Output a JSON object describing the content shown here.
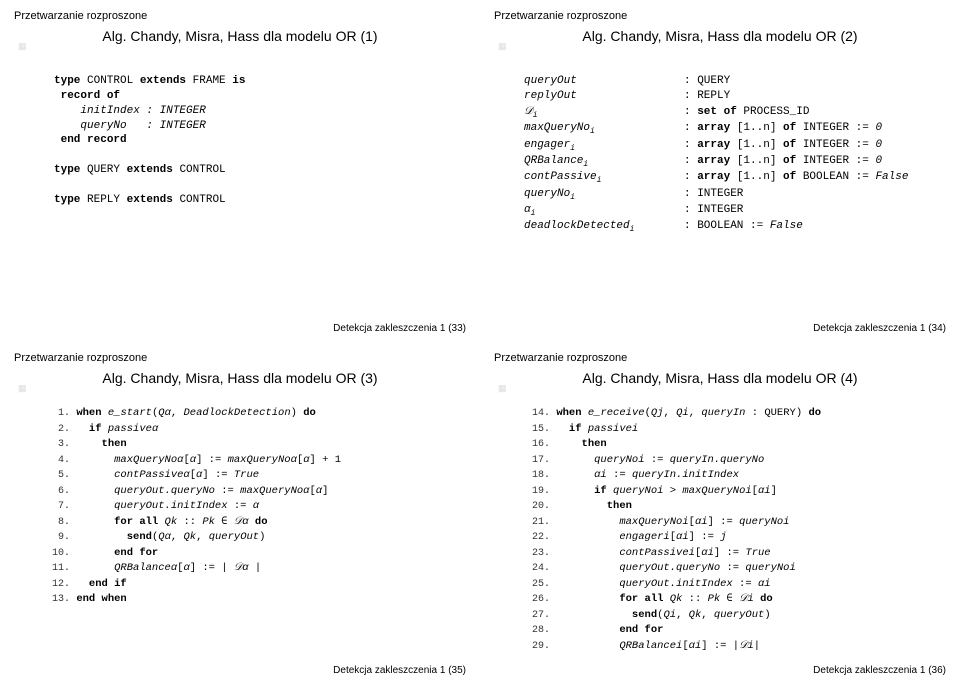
{
  "slides": {
    "s1": {
      "header": "Przetwarzanie rozproszone",
      "title": "Alg. Chandy, Misra, Hass dla modelu OR (1)",
      "footer": "Detekcja zakleszczenia 1 (33)",
      "code": {
        "l1a": "type",
        "l1b": " CONTROL ",
        "l1c": "extends",
        "l1d": " FRAME ",
        "l1e": "is",
        "l2a": "record of",
        "l3": "initIndex : INTEGER",
        "l4": "queryNo   : INTEGER",
        "l5a": "end record",
        "l6a": "type",
        "l6b": " QUERY ",
        "l6c": "extends",
        "l6d": " CONTROL",
        "l7a": "type",
        "l7b": " REPLY ",
        "l7c": "extends",
        "l7d": " CONTROL"
      }
    },
    "s2": {
      "header": "Przetwarzanie rozproszone",
      "title": "Alg. Chandy, Misra, Hass dla modelu OR (2)",
      "footer": "Detekcja zakleszczenia 1 (34)",
      "defs": [
        {
          "k": "queryOut",
          "v": ": QUERY"
        },
        {
          "k": "replyOut",
          "v": ": REPLY"
        },
        {
          "k": "𝒟",
          "sub": "i",
          "v": ": set of PROCESS_ID",
          "kw": "set of"
        },
        {
          "k": "maxQueryNo",
          "sub": "i",
          "v": ": array [1..n] of INTEGER := 0",
          "kw": "array",
          "kw2": "of"
        },
        {
          "k": "engager",
          "sub": "i",
          "v": ": array [1..n] of INTEGER := 0",
          "kw": "array",
          "kw2": "of"
        },
        {
          "k": "QRBalance",
          "sub": "i",
          "v": ": array [1..n] of INTEGER := 0",
          "kw": "array",
          "kw2": "of"
        },
        {
          "k": "contPassive",
          "sub": "i",
          "v": ": array [1..n] of BOOLEAN := False",
          "kw": "array",
          "kw2": "of"
        },
        {
          "k": "queryNo",
          "sub": "i",
          "v": ": INTEGER"
        },
        {
          "k": "α",
          "sub": "i",
          "v": ": INTEGER"
        },
        {
          "k": "deadlockDetected",
          "sub": "i",
          "v": ": BOOLEAN := False"
        }
      ]
    },
    "s3": {
      "header": "Przetwarzanie rozproszone",
      "title": "Alg. Chandy, Misra, Hass dla modelu OR (3)",
      "footer": "Detekcja zakleszczenia 1 (35)",
      "lines": [
        {
          "n": "1.",
          "t": "when e_start(Qα, DeadlockDetection) do",
          "kw": [
            "when",
            "do"
          ],
          "it": [
            "e_start",
            "Qα",
            "DeadlockDetection"
          ]
        },
        {
          "n": "2.",
          "t": "  if passiveα",
          "kw": [
            "if"
          ],
          "it": [
            "passiveα"
          ]
        },
        {
          "n": "3.",
          "t": "    then",
          "kw": [
            "then"
          ]
        },
        {
          "n": "4.",
          "t": "      maxQueryNoα[α] := maxQueryNoα[α] + 1",
          "it": [
            "maxQueryNoα",
            "α",
            "maxQueryNoα",
            "α"
          ]
        },
        {
          "n": "5.",
          "t": "      contPassiveα[α] := True",
          "it": [
            "contPassiveα",
            "α",
            "True"
          ]
        },
        {
          "n": "6.",
          "t": "      queryOut.queryNo := maxQueryNoα[α]",
          "it": [
            "queryOut.queryNo",
            "maxQueryNoα",
            "α"
          ]
        },
        {
          "n": "7.",
          "t": "      queryOut.initIndex := α",
          "it": [
            "queryOut.initIndex",
            "α"
          ]
        },
        {
          "n": "8.",
          "t": "      for all Qk :: Pk ∈ 𝒟α do",
          "kw": [
            "for all",
            "do"
          ],
          "it": [
            "Qk",
            "Pk",
            "𝒟α"
          ]
        },
        {
          "n": "9.",
          "t": "        send(Qα, Qk, queryOut)",
          "kw": [
            "send"
          ],
          "it": [
            "Qα",
            "Qk",
            "queryOut"
          ]
        },
        {
          "n": "10.",
          "t": "      end for",
          "kw": [
            "end for"
          ]
        },
        {
          "n": "11.",
          "t": "      QRBalanceα[α] := | 𝒟α |",
          "it": [
            "QRBalanceα",
            "α",
            "𝒟α"
          ]
        },
        {
          "n": "12.",
          "t": "  end if",
          "kw": [
            "end if"
          ]
        },
        {
          "n": "13.",
          "t": "end when",
          "kw": [
            "end when"
          ]
        }
      ]
    },
    "s4": {
      "header": "Przetwarzanie rozproszone",
      "title": "Alg. Chandy, Misra, Hass dla modelu OR (4)",
      "footer": "Detekcja zakleszczenia 1 (36)",
      "lines": [
        {
          "n": "14.",
          "t": "when e_receive(Qj, Qi, queryIn : QUERY) do",
          "kw": [
            "when",
            "do"
          ],
          "it": [
            "e_receive",
            "Qj",
            "Qi",
            "queryIn"
          ]
        },
        {
          "n": "15.",
          "t": "  if passivei",
          "kw": [
            "if"
          ],
          "it": [
            "passivei"
          ]
        },
        {
          "n": "16.",
          "t": "    then",
          "kw": [
            "then"
          ]
        },
        {
          "n": "17.",
          "t": "      queryNoi := queryIn.queryNo",
          "it": [
            "queryNoi",
            "queryIn.queryNo"
          ]
        },
        {
          "n": "18.",
          "t": "      αi := queryIn.initIndex",
          "it": [
            "αi",
            "queryIn.initIndex"
          ]
        },
        {
          "n": "19.",
          "t": "      if queryNoi > maxQueryNoi[αi]",
          "kw": [
            "if"
          ],
          "it": [
            "queryNoi",
            "maxQueryNoi",
            "αi"
          ]
        },
        {
          "n": "20.",
          "t": "        then",
          "kw": [
            "then"
          ]
        },
        {
          "n": "21.",
          "t": "          maxQueryNoi[αi] := queryNoi",
          "it": [
            "maxQueryNoi",
            "αi",
            "queryNoi"
          ]
        },
        {
          "n": "22.",
          "t": "          engageri[αi] := j",
          "it": [
            "engageri",
            "αi",
            "j"
          ]
        },
        {
          "n": "23.",
          "t": "          contPassivei[αi] := True",
          "it": [
            "contPassivei",
            "αi",
            "True"
          ]
        },
        {
          "n": "24.",
          "t": "          queryOut.queryNo := queryNoi",
          "it": [
            "queryOut.queryNo",
            "queryNoi"
          ]
        },
        {
          "n": "25.",
          "t": "          queryOut.initIndex := αi",
          "it": [
            "queryOut.initIndex",
            "αi"
          ]
        },
        {
          "n": "26.",
          "t": "          for all Qk :: Pk ∈ 𝒟i do",
          "kw": [
            "for all",
            "do"
          ],
          "it": [
            "Qk",
            "Pk",
            "𝒟i"
          ]
        },
        {
          "n": "27.",
          "t": "            send(Qi, Qk, queryOut)",
          "kw": [
            "send"
          ],
          "it": [
            "Qi",
            "Qk",
            "queryOut"
          ]
        },
        {
          "n": "28.",
          "t": "          end for",
          "kw": [
            "end for"
          ]
        },
        {
          "n": "29.",
          "t": "          QRBalancei[αi] := |𝒟i|",
          "it": [
            "QRBalancei",
            "αi",
            "𝒟i"
          ]
        }
      ]
    }
  }
}
